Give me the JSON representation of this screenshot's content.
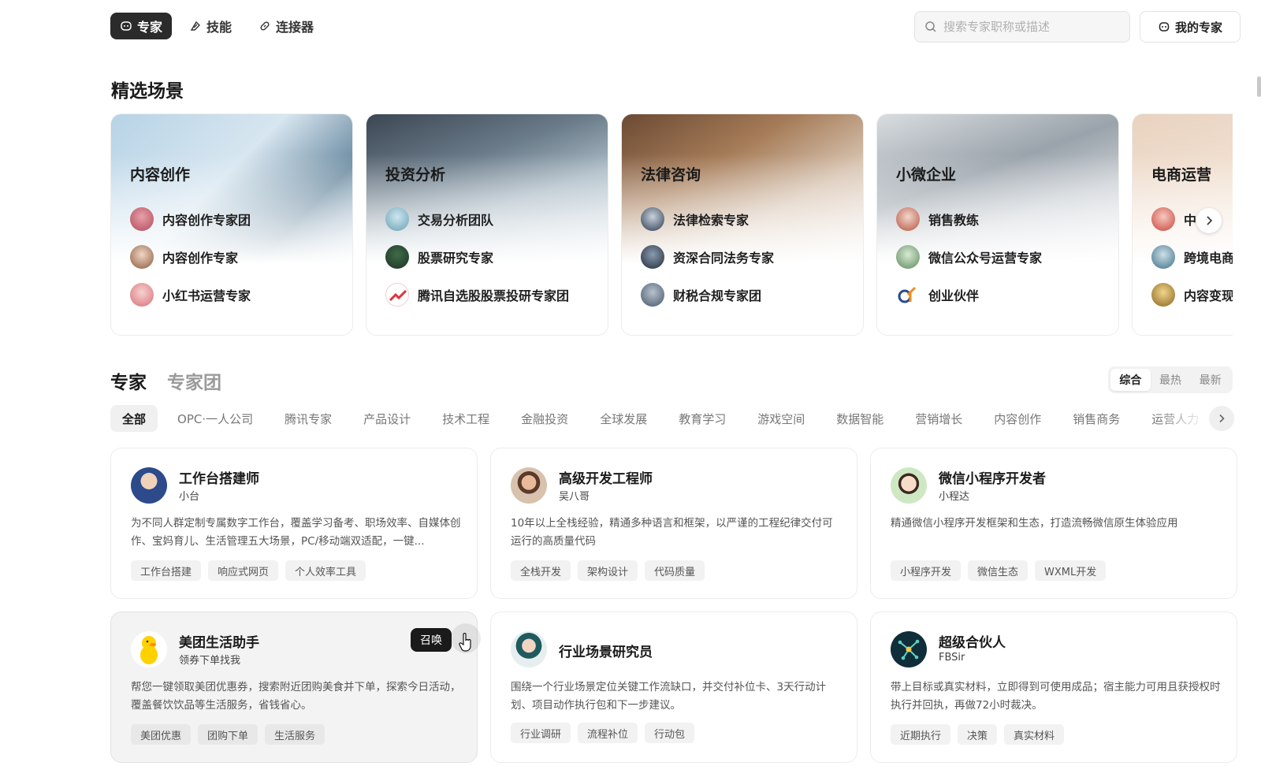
{
  "topnav": {
    "tabs": [
      {
        "label": "专家",
        "icon": "expert-icon",
        "active": true
      },
      {
        "label": "技能",
        "icon": "skill-icon",
        "active": false
      },
      {
        "label": "连接器",
        "icon": "link-icon",
        "active": false
      }
    ],
    "search_placeholder": "搜索专家职称或描述",
    "my_experts_label": "我的专家"
  },
  "featured": {
    "title": "精选场景",
    "scenes": [
      {
        "title": "内容创作",
        "items": [
          "内容创作专家团",
          "内容创作专家",
          "小红书运营专家"
        ]
      },
      {
        "title": "投资分析",
        "items": [
          "交易分析团队",
          "股票研究专家",
          "腾讯自选股股票投研专家团"
        ]
      },
      {
        "title": "法律咨询",
        "items": [
          "法律检索专家",
          "资深合同法务专家",
          "财税合规专家团"
        ]
      },
      {
        "title": "小微企业",
        "items": [
          "销售教练",
          "微信公众号运营专家",
          "创业伙伴"
        ]
      },
      {
        "title": "电商运营",
        "items": [
          "中",
          "跨境电商",
          "内容变现"
        ]
      }
    ]
  },
  "experts": {
    "tab_experts": "专家",
    "tab_teams": "专家团",
    "sort": [
      "综合",
      "最热",
      "最新"
    ],
    "categories": [
      "全部",
      "OPC·一人公司",
      "腾讯专家",
      "产品设计",
      "技术工程",
      "金融投资",
      "全球发展",
      "教育学习",
      "游戏空间",
      "数据智能",
      "营销增长",
      "内容创作",
      "销售商务",
      "运营人力"
    ],
    "summon_label": "召唤",
    "cards": [
      {
        "name": "工作台搭建师",
        "sub": "小台",
        "desc": "为不同人群定制专属数字工作台，覆盖学习备考、职场效率、自媒体创作、宝妈育儿、生活管理五大场景，PC/移动端双适配，一键...",
        "tags": [
          "工作台搭建",
          "响应式网页",
          "个人效率工具"
        ]
      },
      {
        "name": "高级开发工程师",
        "sub": "吴八哥",
        "desc": "10年以上全栈经验，精通多种语言和框架，以严谨的工程纪律交付可运行的高质量代码",
        "tags": [
          "全栈开发",
          "架构设计",
          "代码质量"
        ]
      },
      {
        "name": "微信小程序开发者",
        "sub": "小程达",
        "desc": "精通微信小程序开发框架和生态，打造流畅微信原生体验应用",
        "tags": [
          "小程序开发",
          "微信生态",
          "WXML开发"
        ]
      },
      {
        "name": "美团生活助手",
        "sub": "领券下单找我",
        "desc": "帮您一键领取美团优惠券，搜索附近团购美食并下单，探索今日活动，覆盖餐饮饮品等生活服务，省钱省心。",
        "tags": [
          "美团优惠",
          "团购下单",
          "生活服务"
        ]
      },
      {
        "name": "行业场景研究员",
        "sub": "",
        "desc": "围绕一个行业场景定位关键工作流缺口，并交付补位卡、3天行动计划、项目动作执行包和下一步建议。",
        "tags": [
          "行业调研",
          "流程补位",
          "行动包"
        ]
      },
      {
        "name": "超级合伙人",
        "sub": "FBSir",
        "desc": "带上目标或真实材料，立即得到可使用成品；宿主能力可用且获授权时执行并回执，再做72小时裁决。",
        "tags": [
          "近期执行",
          "决策",
          "真实材料"
        ]
      }
    ]
  }
}
